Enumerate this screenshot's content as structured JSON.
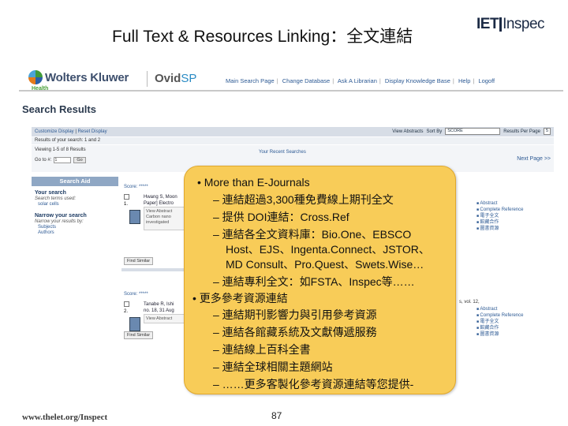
{
  "slide": {
    "title": "Full Text & Resources Linking：全文連結",
    "logo": {
      "left": "IET",
      "right": "Inspec"
    },
    "footer_url": "www.thelet.org/Inspect",
    "page_number": "87"
  },
  "ovid": {
    "brand": "Wolters Kluwer",
    "brand_sub": "Health",
    "product": {
      "a": "Ovid",
      "b": "SP"
    },
    "nav": [
      "Main Search Page",
      "Change Database",
      "Ask A Librarian",
      "Display Knowledge Base",
      "Help",
      "Logoff"
    ],
    "page_title": "Search Results",
    "toolbar": {
      "customize": "Customize Display",
      "reset": "Reset Display",
      "view_abstracts": "View Abstracts",
      "sort_by": "Sort By",
      "sort_value": "SCORE",
      "per_page_label": "Results Per Page",
      "per_page_value": "5"
    },
    "results_of": "Results of your search: 1 and 2",
    "viewing": "Viewing 1-5 of 8 Results",
    "goto_label": "Go to #:",
    "goto_value": "1",
    "goto_btn": "Go",
    "recent": "Your Recent Searches",
    "next_page": "Next Page >>",
    "search_aid": {
      "tab": "Search Aid",
      "your_search": "Your search",
      "terms_used": "Search terms used:",
      "term": "solar cells",
      "narrow": "Narrow your search",
      "narrow_sub": "Narrow your results by:",
      "items": [
        "Subjects",
        "Authors"
      ]
    },
    "results": [
      {
        "score": "Score:",
        "stars": "*****",
        "num": "1.",
        "text1": "Hwang S, Moon",
        "text2": "Paper] Electro",
        "abstract_btn": "View Abstract",
        "abstract_text1": "Carbon nano",
        "abstract_text2": "investigated",
        "find_similar": "Find Similar"
      },
      {
        "score": "Score:",
        "stars": "*****",
        "num": "2.",
        "text1": "Tanabe R, Ishi",
        "text2": "no. 18, 31 Aug",
        "abstract_btn": "View Abstract",
        "abstract_text1": "",
        "abstract_text2": "",
        "find_similar": "Find Similar"
      }
    ],
    "right_links_1": [
      "Abstract",
      "Complete Reference",
      "電子全文",
      "館藏合作",
      "圖書資源"
    ],
    "right_links_2": [
      "Abstract",
      "Complete Reference",
      "電子全文",
      "館藏合作",
      "圖書資源"
    ],
    "vol_text": "s, vol. 12,"
  },
  "callout": {
    "lines": [
      "• More than E-Journals",
      "– 連結超過3,300種免費線上期刊全文",
      "– 提供 DOI連結：Cross.Ref",
      "– 連結各全文資料庫：Bio.One、EBSCO",
      "Host、EJS、Ingenta.Connect、JSTOR、",
      "MD Consult、Pro.Quest、Swets.Wise…",
      "– 連結專利全文：如FSTA、Inspec等……",
      "• 更多參考資源連結",
      "– 連結期刊影響力與引用參考資源",
      "– 連結各館藏系統及文獻傳遞服務",
      "– 連結線上百科全書",
      "– 連結全球相關主題網站",
      "– ……更多客製化參考資源連結等您提供-"
    ]
  },
  "colors": {
    "callout": "#f8cc58",
    "ovid_link": "#2d5a94",
    "toolbar": "#d7dde6"
  }
}
